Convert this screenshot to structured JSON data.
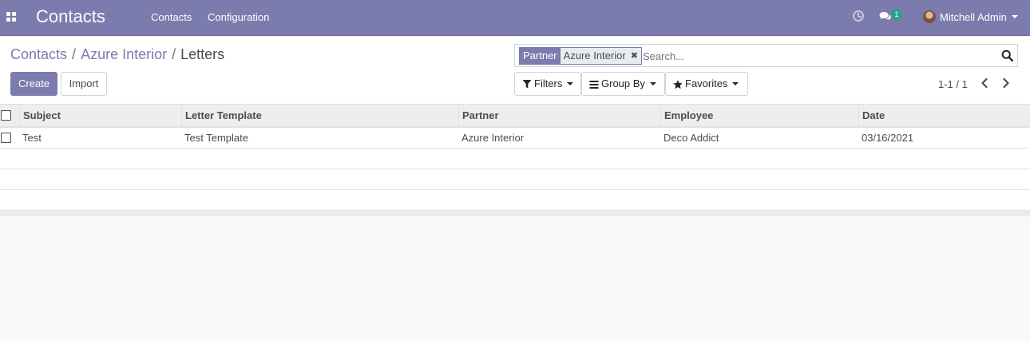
{
  "navbar": {
    "app_title": "Contacts",
    "menu": [
      "Contacts",
      "Configuration"
    ],
    "messages_count": "1",
    "user_name": "Mitchell Admin",
    "bg_color": "#7c7bad"
  },
  "breadcrumb": [
    {
      "label": "Contacts"
    },
    {
      "label": "Azure Interior"
    },
    {
      "label": "Letters"
    }
  ],
  "breadcrumb_separator": "/",
  "buttons": {
    "create": "Create",
    "import": "Import"
  },
  "search": {
    "facet_label": "Partner",
    "facet_value": "Azure Interior",
    "facet_remove_icon": "close-icon",
    "placeholder": "Search..."
  },
  "dropdowns": {
    "filters": "Filters",
    "group_by": "Group By",
    "favorites": "Favorites"
  },
  "pager": {
    "value": "1-1 / 1"
  },
  "table": {
    "columns": [
      "Subject",
      "Letter Template",
      "Partner",
      "Employee",
      "Date"
    ],
    "rows": [
      [
        "Test",
        "Test Template",
        "Azure Interior",
        "Deco Addict",
        "03/16/2021"
      ]
    ]
  }
}
